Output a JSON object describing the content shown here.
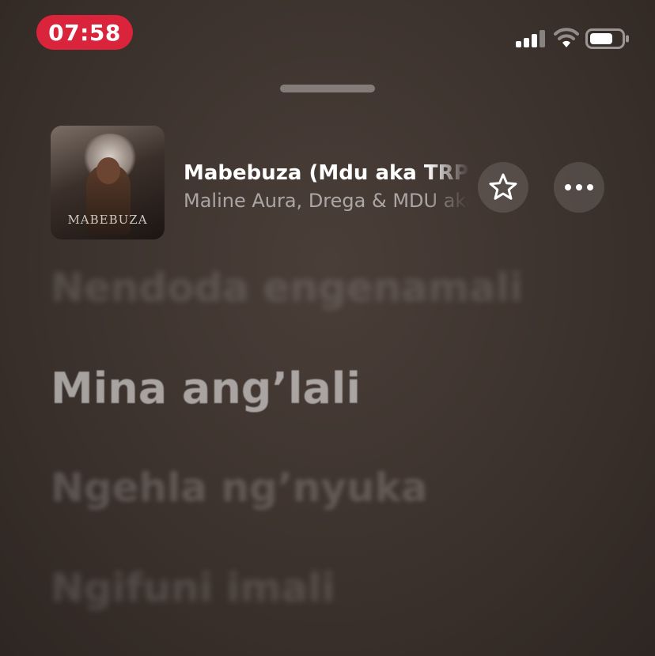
{
  "status_bar": {
    "time": "07:58",
    "signal_icon": "cellular-signal-icon",
    "wifi_icon": "wifi-icon",
    "battery_icon": "battery-icon"
  },
  "now_playing": {
    "artwork_text": "MABEBUZA",
    "title": "Mabebuza (Mdu aka TRP",
    "artist": "Maline Aura, Drega & MDU aka",
    "favorite_icon": "star-icon",
    "more_icon": "ellipsis-icon"
  },
  "lyrics": {
    "previous": "Nendoda engenamali",
    "current": "Mina ang’lali",
    "next": [
      "Ngehla ng’nyuka",
      "Ngifuni imali"
    ]
  },
  "colors": {
    "time_pill": "#d9243b",
    "background": "#3c322d"
  }
}
